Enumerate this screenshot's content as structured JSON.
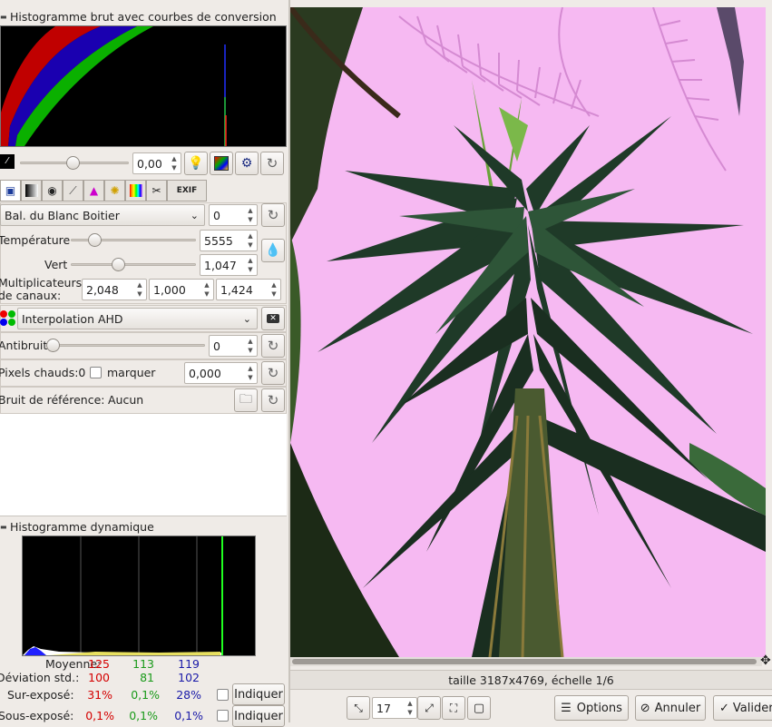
{
  "raw_histogram": {
    "title": "Histogramme brut avec courbes de conversion"
  },
  "exposure": {
    "value": "0,00"
  },
  "white_balance": {
    "preset": "Bal. du Blanc Boitier",
    "preset_value": "0",
    "temperature_label": "Température",
    "temperature_value": "5555",
    "green_label": "Vert",
    "green_value": "1,047",
    "multipliers_label_1": "Multiplicateurs",
    "multipliers_label_2": "de canaux:",
    "multiplier_r": "2,048",
    "multiplier_g": "1,000",
    "multiplier_b": "1,424"
  },
  "interpolation": {
    "selected": "Interpolation AHD"
  },
  "denoise": {
    "label": "Antibruit",
    "value": "0"
  },
  "hot_pixels": {
    "label": "Pixels chauds:0",
    "mark_label": "marquer",
    "value": "0,000"
  },
  "dark_frame": {
    "label": "Bruit de référence:",
    "value": "Aucun"
  },
  "live_histogram": {
    "title": "Histogramme dynamique",
    "mean_label": "Moyenne:",
    "mean": [
      "125",
      "113",
      "119"
    ],
    "std_label": "Déviation std.:",
    "std": [
      "100",
      "81",
      "102"
    ],
    "over_label": "Sur-exposé:",
    "over": [
      "31%",
      "0,1%",
      "28%"
    ],
    "under_label": "Sous-exposé:",
    "under": [
      "0,1%",
      "0,1%",
      "0,1%"
    ],
    "indicate_label": "Indiquer"
  },
  "status": {
    "text": "taille 3187x4769, échelle 1/6"
  },
  "bottom_bar": {
    "zoom_value": "17",
    "options_label": "Options",
    "cancel_label": "Annuler",
    "ok_label": "Valider"
  },
  "colors": {
    "red": "#d40000",
    "green": "#1a9a1a",
    "blue": "#1a1aa8",
    "overexposed_pink": "#f6b9f2"
  }
}
